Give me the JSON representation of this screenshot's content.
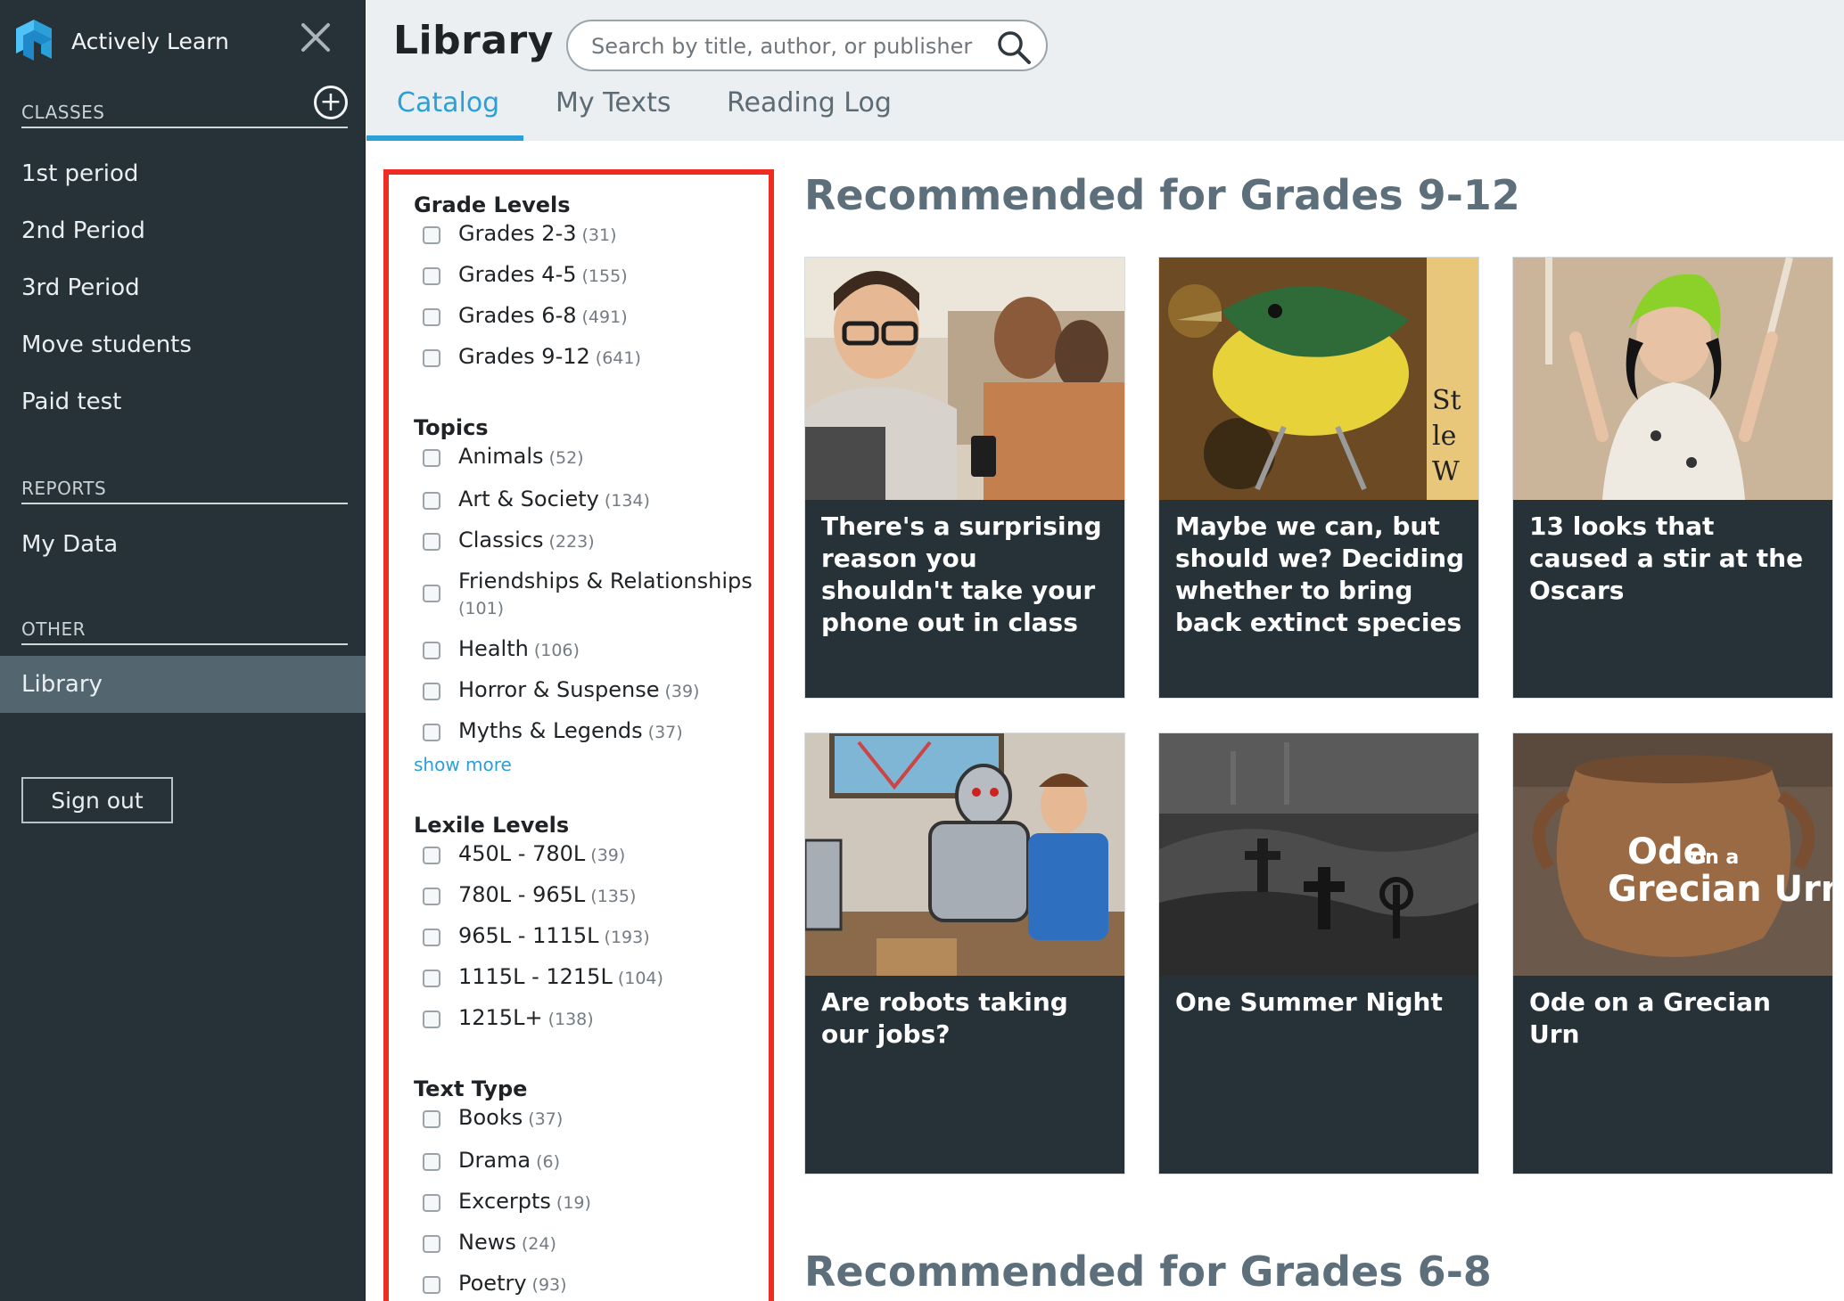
{
  "app": {
    "name": "Actively Learn",
    "accent_color": "#2a9fd8",
    "sidebar_color": "#263238"
  },
  "sidebar": {
    "classes_label": "CLASSES",
    "classes": [
      {
        "label": "1st period"
      },
      {
        "label": "2nd Period"
      },
      {
        "label": "3rd Period"
      },
      {
        "label": "Move students"
      },
      {
        "label": "Paid test"
      }
    ],
    "reports_label": "REPORTS",
    "reports": [
      {
        "label": "My Data"
      }
    ],
    "other_label": "OTHER",
    "other": [
      {
        "label": "Library",
        "active": true
      }
    ],
    "sign_out_label": "Sign out"
  },
  "header": {
    "title": "Library",
    "search_placeholder": "Search by title, author, or publisher",
    "tabs": [
      {
        "label": "Catalog",
        "active": true
      },
      {
        "label": "My Texts",
        "active": false
      },
      {
        "label": "Reading Log",
        "active": false
      }
    ]
  },
  "filters": {
    "grade_levels": {
      "title": "Grade Levels",
      "options": [
        {
          "label": "Grades 2-3",
          "count": "(31)"
        },
        {
          "label": "Grades 4-5",
          "count": "(155)"
        },
        {
          "label": "Grades 6-8",
          "count": "(491)"
        },
        {
          "label": "Grades 9-12",
          "count": "(641)"
        }
      ]
    },
    "topics": {
      "title": "Topics",
      "options": [
        {
          "label": "Animals",
          "count": "(52)"
        },
        {
          "label": "Art & Society",
          "count": "(134)"
        },
        {
          "label": "Classics",
          "count": "(223)"
        },
        {
          "label": "Friendships & Relationships",
          "count": "(101)"
        },
        {
          "label": "Health",
          "count": "(106)"
        },
        {
          "label": "Horror & Suspense",
          "count": "(39)"
        },
        {
          "label": "Myths & Legends",
          "count": "(37)"
        }
      ],
      "show_more": "show more"
    },
    "lexile_levels": {
      "title": "Lexile Levels",
      "options": [
        {
          "label": "450L - 780L",
          "count": "(39)"
        },
        {
          "label": "780L - 965L",
          "count": "(135)"
        },
        {
          "label": "965L - 1115L",
          "count": "(193)"
        },
        {
          "label": "1115L - 1215L",
          "count": "(104)"
        },
        {
          "label": "1215L+",
          "count": "(138)"
        }
      ]
    },
    "text_type": {
      "title": "Text Type",
      "options": [
        {
          "label": "Books",
          "count": "(37)"
        },
        {
          "label": "Drama",
          "count": "(6)"
        },
        {
          "label": "Excerpts",
          "count": "(19)"
        },
        {
          "label": "News",
          "count": "(24)"
        },
        {
          "label": "Poetry",
          "count": "(93)"
        }
      ]
    }
  },
  "recommended_9_12": {
    "heading": "Recommended for Grades 9-12",
    "cards": [
      {
        "title": "There's a surprising reason you shouldn't take your phone out in class",
        "image": "students-with-phones-photo"
      },
      {
        "title": "Maybe we can, but should we? Deciding whether to bring back extinct species",
        "image": "extinct-bird-illustration"
      },
      {
        "title": "13 looks that caused a stir at the Oscars",
        "image": "oscars-red-carpet-photo"
      },
      {
        "title": "Are robots taking our jobs?",
        "image": "robot-and-worker-illustration"
      },
      {
        "title": "One Summer Night",
        "image": "graveyard-photo"
      },
      {
        "title": "Ode on a Grecian Urn",
        "image": "grecian-urn-photo",
        "image_caption_line1": "Ode",
        "image_caption_on_a": "on a",
        "image_caption_line2": "Grecian Urn"
      }
    ]
  },
  "recommended_6_8": {
    "heading": "Recommended for Grades 6-8"
  }
}
